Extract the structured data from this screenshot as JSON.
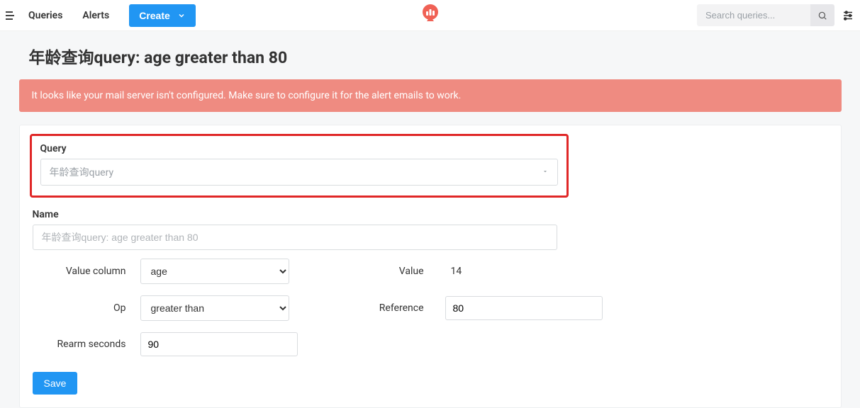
{
  "header": {
    "nav": {
      "queries": "Queries",
      "alerts": "Alerts"
    },
    "create_label": "Create",
    "search_placeholder": "Search queries..."
  },
  "page": {
    "title": "年龄查询query: age greater than 80",
    "alert_message": "It looks like your mail server isn't configured. Make sure to configure it for the alert emails to work."
  },
  "form": {
    "query_label": "Query",
    "query_selected": "年龄查询query",
    "name_label": "Name",
    "name_placeholder": "年龄查询query: age greater than 80",
    "value_column_label": "Value column",
    "value_column_value": "age",
    "value_label": "Value",
    "value_value": "14",
    "op_label": "Op",
    "op_value": "greater than",
    "reference_label": "Reference",
    "reference_value": "80",
    "rearm_label": "Rearm seconds",
    "rearm_value": "90",
    "save_label": "Save"
  }
}
